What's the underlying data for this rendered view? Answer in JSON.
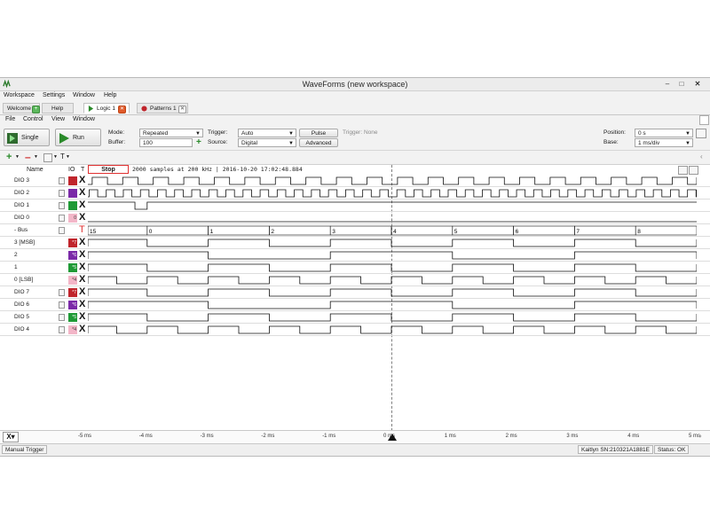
{
  "window": {
    "title": "WaveForms  (new workspace)"
  },
  "menubar": [
    "Workspace",
    "Settings",
    "Window",
    "Help"
  ],
  "tabs": [
    {
      "label": "Welcome",
      "active": false
    },
    {
      "label": "Help",
      "active": false
    },
    {
      "label": "Logic 1",
      "active": true
    },
    {
      "label": "Patterns 1",
      "active": false
    }
  ],
  "submenu": [
    "File",
    "Control",
    "View",
    "Window"
  ],
  "controls": {
    "single": "Single",
    "run": "Run",
    "mode_label": "Mode:",
    "mode_value": "Repeated",
    "buffer_label": "Buffer:",
    "buffer_value": "100",
    "trigger_label": "Trigger:",
    "trigger_value": "Auto",
    "source_label": "Source:",
    "source_value": "Digital",
    "pulse": "Pulse",
    "advanced": "Advanced",
    "trigger_status": "Trigger: None",
    "position_label": "Position:",
    "position_value": "0 s",
    "base_label": "Base:",
    "base_value": "1 ms/div"
  },
  "plot": {
    "name_header": "Name",
    "io_header": "IO",
    "t_header": "T",
    "stop_label": "Stop",
    "status": "2000 samples at 200 kHz | 2016-10-20 17:02:48.884",
    "rows": [
      {
        "name": "DIO 3",
        "io_color": "#c0252c",
        "io_text": "",
        "trig": "X",
        "edit": true
      },
      {
        "name": "DIO 2",
        "io_color": "#7b2aa8",
        "io_text": "",
        "trig": "X",
        "edit": true
      },
      {
        "name": "DIO 1",
        "io_color": "#1f9a36",
        "io_text": "",
        "trig": "X",
        "edit": true
      },
      {
        "name": "DIO 0",
        "io_color": "#f3b6c8",
        "io_text": "0",
        "trig": "X",
        "edit": true
      },
      {
        "name": "- Bus",
        "io_color": "",
        "io_text": "",
        "trig": "T",
        "edit": true
      },
      {
        "name": "3 [MSB]",
        "io_color": "#c0252c",
        "io_text": "*7",
        "trig": "X",
        "edit": false
      },
      {
        "name": "2",
        "io_color": "#7b2aa8",
        "io_text": "*6",
        "trig": "X",
        "edit": false
      },
      {
        "name": "1",
        "io_color": "#1f9a36",
        "io_text": "*5",
        "trig": "X",
        "edit": false
      },
      {
        "name": "0 [LSB]",
        "io_color": "#f3b6c8",
        "io_text": "*4",
        "trig": "X",
        "edit": false
      },
      {
        "name": "DIO 7",
        "io_color": "#c0252c",
        "io_text": "*7",
        "trig": "X",
        "edit": true
      },
      {
        "name": "DIO 6",
        "io_color": "#7b2aa8",
        "io_text": "*6",
        "trig": "X",
        "edit": true
      },
      {
        "name": "DIO 5",
        "io_color": "#1f9a36",
        "io_text": "*5",
        "trig": "X",
        "edit": true
      },
      {
        "name": "DIO 4",
        "io_color": "#f3b6c8",
        "io_text": "*4",
        "trig": "X",
        "edit": true
      }
    ],
    "bus_values": [
      "15",
      "0",
      "1",
      "2",
      "3",
      "4",
      "5",
      "6",
      "7",
      "8"
    ]
  },
  "xaxis": {
    "ticks": [
      "-5 ms",
      "-4 ms",
      "-3 ms",
      "-2 ms",
      "-1 ms",
      "0 ms",
      "1 ms",
      "2 ms",
      "3 ms",
      "4 ms",
      "5 ms"
    ]
  },
  "status": {
    "left": "Manual Trigger",
    "device": "Kaitlyn SN:210321A1881E",
    "state": "Status: OK"
  },
  "colors": {
    "trigger_red": "#e03030",
    "accent_green": "#2a8a2a"
  }
}
